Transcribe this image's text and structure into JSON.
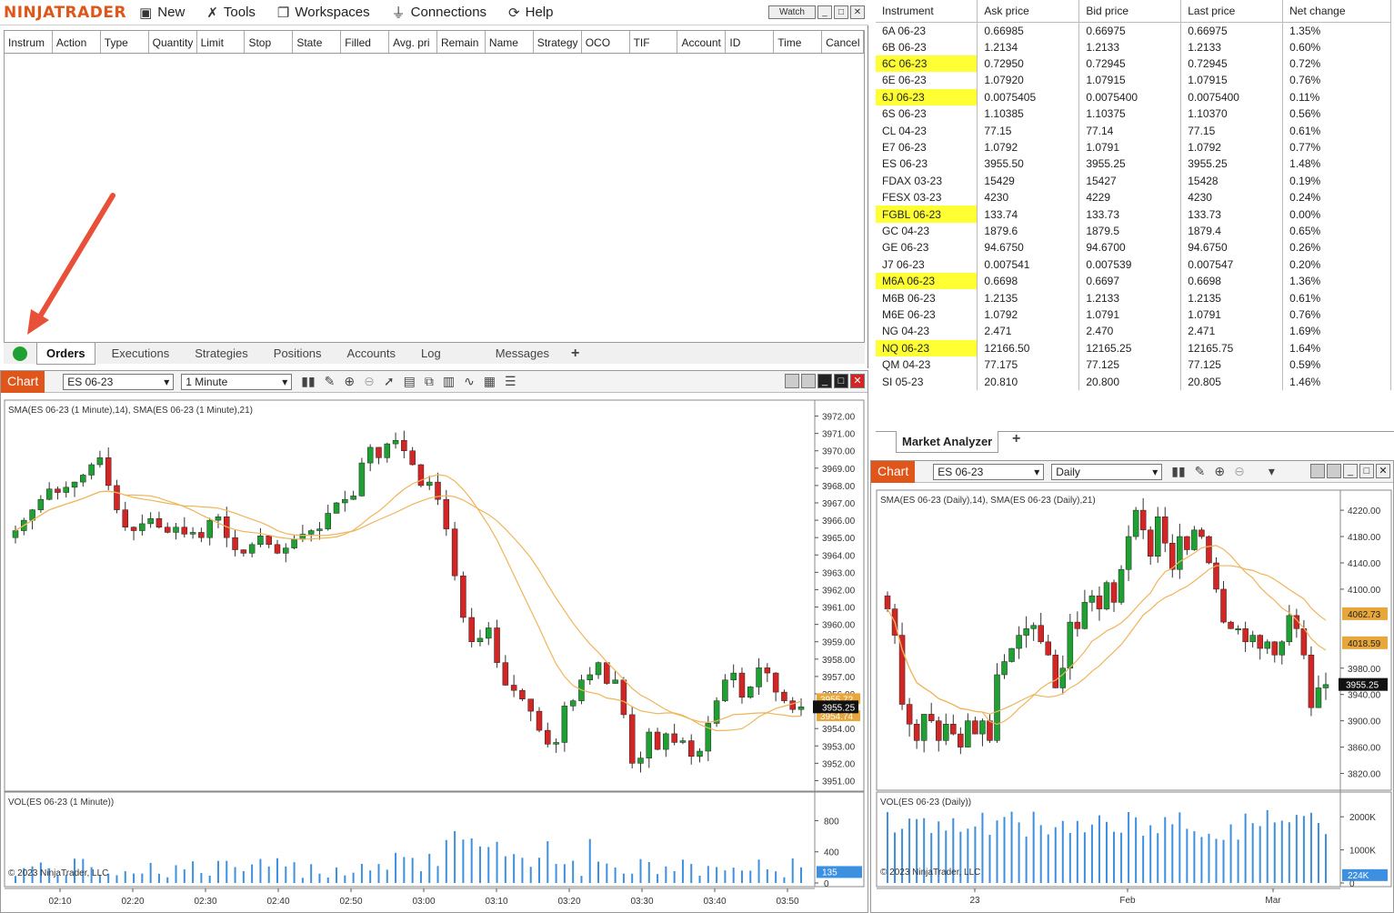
{
  "menubar": {
    "logo": "NINJATRADER",
    "items": [
      {
        "label": "New",
        "icon": "new-window-icon"
      },
      {
        "label": "Tools",
        "icon": "tools-icon"
      },
      {
        "label": "Workspaces",
        "icon": "workspaces-icon"
      },
      {
        "label": "Connections",
        "icon": "connections-icon"
      },
      {
        "label": "Help",
        "icon": "help-icon"
      }
    ],
    "watch_label": "Watch"
  },
  "orders": {
    "columns": [
      "Instrum",
      "Action",
      "Type",
      "Quantity",
      "Limit",
      "Stop",
      "State",
      "Filled",
      "Avg. pri",
      "Remain",
      "Name",
      "Strategy",
      "OCO",
      "TIF",
      "Account",
      "ID",
      "Time",
      "Cancel"
    ],
    "tabs": [
      "Orders",
      "Executions",
      "Strategies",
      "Positions",
      "Accounts",
      "Log",
      "Messages"
    ],
    "active_tab": "Orders",
    "connection_status_color": "#1fa032"
  },
  "chart1": {
    "tab_label": "Chart",
    "instrument": "ES 06-23",
    "interval": "1 Minute",
    "indicator_label": "SMA(ES 06-23 (1 Minute),14), SMA(ES 06-23 (1 Minute),21)",
    "volume_label": "VOL(ES 06-23 (1 Minute))",
    "price_ticks": [
      "3972.00",
      "3971.00",
      "3970.00",
      "3969.00",
      "3968.00",
      "3967.00",
      "3966.00",
      "3965.00",
      "3964.00",
      "3963.00",
      "3962.00",
      "3961.00",
      "3960.00",
      "3959.00",
      "3958.00",
      "3957.00",
      "3956.00",
      "3955.00",
      "3954.00",
      "3953.00",
      "3952.00",
      "3951.00"
    ],
    "last_price": "3955.25",
    "sma_fast_label": "3955.72",
    "sma_slow_label": "3954.74",
    "volume_ticks": [
      "800",
      "400",
      "0"
    ],
    "volume_last": "135",
    "time_ticks": [
      "02:10",
      "02:20",
      "02:30",
      "02:40",
      "02:50",
      "03:00",
      "03:10",
      "03:20",
      "03:30",
      "03:40",
      "03:50"
    ],
    "copyright": "© 2023 NinjaTrader, LLC"
  },
  "chart2": {
    "tab_label": "Chart",
    "instrument": "ES 06-23",
    "interval": "Daily",
    "indicator_label": "SMA(ES 06-23 (Daily),14), SMA(ES 06-23 (Daily),21)",
    "volume_label": "VOL(ES 06-23 (Daily))",
    "price_ticks": [
      "4220.00",
      "4180.00",
      "4140.00",
      "4100.00",
      "4062.73",
      "4018.59",
      "3980.00",
      "3955.25",
      "3940.00",
      "3900.00",
      "3860.00",
      "3820.00"
    ],
    "sma_fast_label": "4062.73",
    "sma_slow_label": "4018.59",
    "last_price": "3955.25",
    "volume_ticks": [
      "2000K",
      "1000K",
      "0"
    ],
    "volume_last": "224K",
    "time_ticks": [
      "23",
      "Feb",
      "Mar"
    ],
    "copyright": "© 2023 NinjaTrader, LLC"
  },
  "market_analyzer": {
    "tab_label": "Market Analyzer",
    "columns": [
      "Instrument",
      "Ask price",
      "Bid price",
      "Last price",
      "Net change"
    ],
    "rows": [
      {
        "instrument": "6A 06-23",
        "ask": "0.66985",
        "bid": "0.66975",
        "last": "0.66975",
        "change": "1.35%",
        "highlight": false
      },
      {
        "instrument": "6B 06-23",
        "ask": "1.2134",
        "bid": "1.2133",
        "last": "1.2133",
        "change": "0.60%",
        "highlight": false
      },
      {
        "instrument": "6C 06-23",
        "ask": "0.72950",
        "bid": "0.72945",
        "last": "0.72945",
        "change": "0.72%",
        "highlight": true
      },
      {
        "instrument": "6E 06-23",
        "ask": "1.07920",
        "bid": "1.07915",
        "last": "1.07915",
        "change": "0.76%",
        "highlight": false
      },
      {
        "instrument": "6J 06-23",
        "ask": "0.0075405",
        "bid": "0.0075400",
        "last": "0.0075400",
        "change": "0.11%",
        "highlight": true
      },
      {
        "instrument": "6S 06-23",
        "ask": "1.10385",
        "bid": "1.10375",
        "last": "1.10370",
        "change": "0.56%",
        "highlight": false
      },
      {
        "instrument": "CL 04-23",
        "ask": "77.15",
        "bid": "77.14",
        "last": "77.15",
        "change": "0.61%",
        "highlight": false
      },
      {
        "instrument": "E7 06-23",
        "ask": "1.0792",
        "bid": "1.0791",
        "last": "1.0792",
        "change": "0.77%",
        "highlight": false
      },
      {
        "instrument": "ES 06-23",
        "ask": "3955.50",
        "bid": "3955.25",
        "last": "3955.25",
        "change": "1.48%",
        "highlight": false
      },
      {
        "instrument": "FDAX 03-23",
        "ask": "15429",
        "bid": "15427",
        "last": "15428",
        "change": "0.19%",
        "highlight": false
      },
      {
        "instrument": "FESX 03-23",
        "ask": "4230",
        "bid": "4229",
        "last": "4230",
        "change": "0.24%",
        "highlight": false
      },
      {
        "instrument": "FGBL 06-23",
        "ask": "133.74",
        "bid": "133.73",
        "last": "133.73",
        "change": "0.00%",
        "highlight": true
      },
      {
        "instrument": "GC 04-23",
        "ask": "1879.6",
        "bid": "1879.5",
        "last": "1879.4",
        "change": "0.65%",
        "highlight": false
      },
      {
        "instrument": "GE 06-23",
        "ask": "94.6750",
        "bid": "94.6700",
        "last": "94.6750",
        "change": "0.26%",
        "highlight": false
      },
      {
        "instrument": "J7 06-23",
        "ask": "0.007541",
        "bid": "0.007539",
        "last": "0.007547",
        "change": "0.20%",
        "highlight": false
      },
      {
        "instrument": "M6A 06-23",
        "ask": "0.6698",
        "bid": "0.6697",
        "last": "0.6698",
        "change": "1.36%",
        "highlight": true
      },
      {
        "instrument": "M6B 06-23",
        "ask": "1.2135",
        "bid": "1.2133",
        "last": "1.2135",
        "change": "0.61%",
        "highlight": false
      },
      {
        "instrument": "M6E 06-23",
        "ask": "1.0792",
        "bid": "1.0791",
        "last": "1.0791",
        "change": "0.76%",
        "highlight": false
      },
      {
        "instrument": "NG 04-23",
        "ask": "2.471",
        "bid": "2.470",
        "last": "2.471",
        "change": "1.69%",
        "highlight": false
      },
      {
        "instrument": "NQ 06-23",
        "ask": "12166.50",
        "bid": "12165.25",
        "last": "12165.75",
        "change": "1.64%",
        "highlight": true
      },
      {
        "instrument": "QM 04-23",
        "ask": "77.175",
        "bid": "77.125",
        "last": "77.125",
        "change": "0.59%",
        "highlight": false
      },
      {
        "instrument": "SI 05-23",
        "ask": "20.810",
        "bid": "20.800",
        "last": "20.805",
        "change": "1.46%",
        "highlight": false
      }
    ]
  },
  "colors": {
    "brand": "#e0561a",
    "up_candle": "#1fa032",
    "down_candle": "#d42525",
    "sma": "#f0b45a",
    "volume": "#3d8fe0",
    "highlight": "#ffff33"
  }
}
